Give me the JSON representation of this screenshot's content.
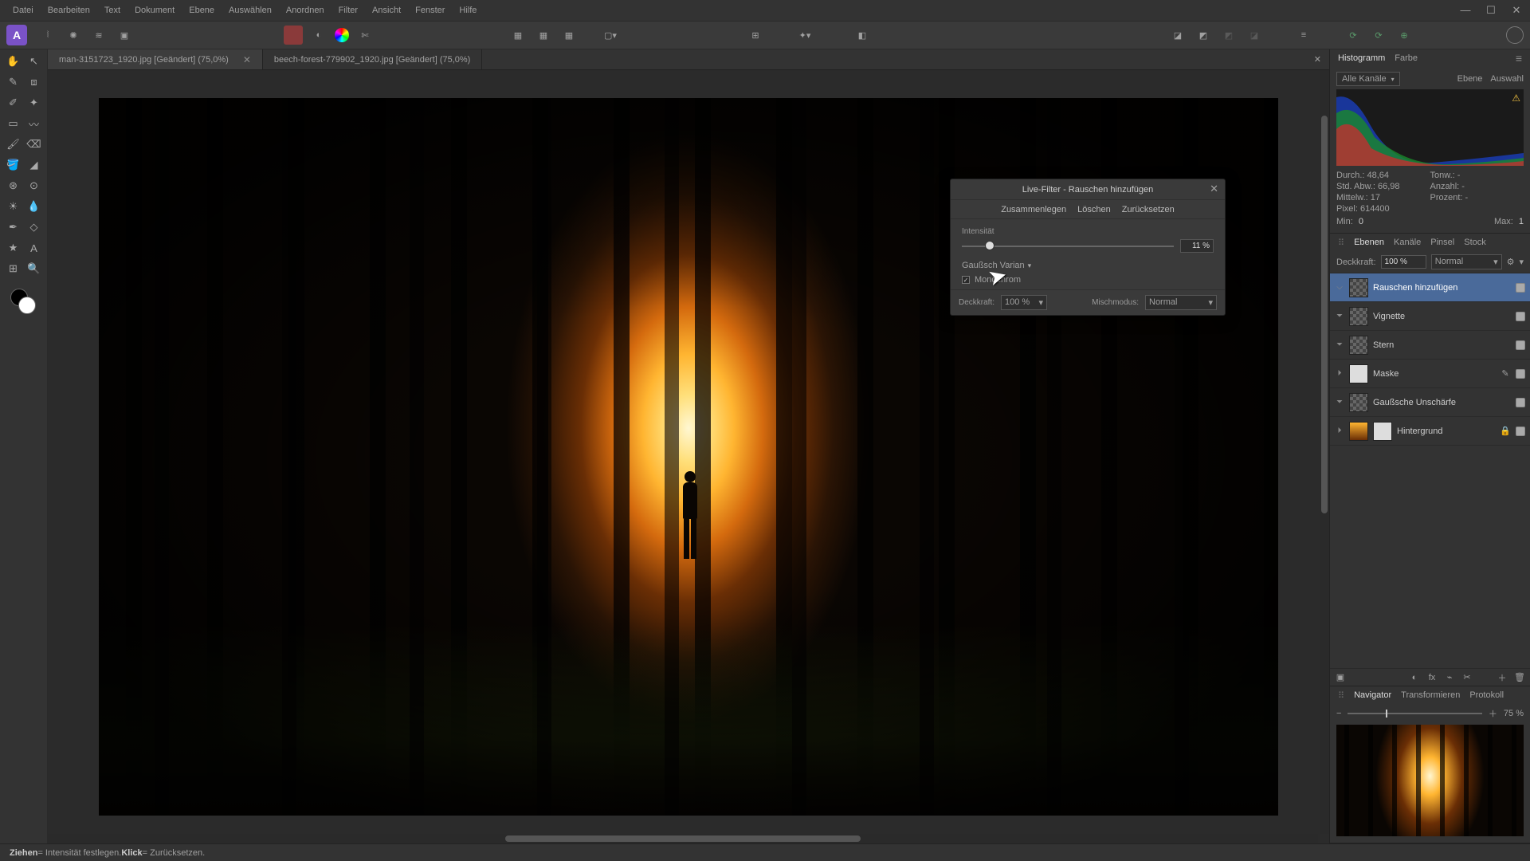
{
  "menu": [
    "Datei",
    "Bearbeiten",
    "Text",
    "Dokument",
    "Ebene",
    "Auswählen",
    "Anordnen",
    "Filter",
    "Ansicht",
    "Fenster",
    "Hilfe"
  ],
  "tabs": [
    {
      "label": "man-3151723_1920.jpg [Geändert] (75,0%)"
    },
    {
      "label": "beech-forest-779902_1920.jpg [Geändert] (75,0%)"
    }
  ],
  "dialog": {
    "title": "Live-Filter - Rauschen hinzufügen",
    "actions": [
      "Zusammenlegen",
      "Löschen",
      "Zurücksetzen"
    ],
    "intensity_label": "Intensität",
    "intensity_value": "11 %",
    "intensity_pct": 11,
    "distribution": "Gaußsch Varian",
    "mono_label": "Monochrom",
    "mono_checked": true,
    "opacity_label": "Deckkraft:",
    "opacity_value": "100 %",
    "blend_label": "Mischmodus:",
    "blend_value": "Normal"
  },
  "histogram": {
    "tabs": [
      "Histogramm",
      "Farbe"
    ],
    "channel": "Alle Kanäle",
    "links": [
      "Ebene",
      "Auswahl"
    ],
    "stats": {
      "durch": "Durch.: 48,64",
      "stdabw": "Std. Abw.: 66,98",
      "mittelw": "Mittelw.: 17",
      "pixel": "Pixel: 614400",
      "tonw": "Tonw.: -",
      "anzahl": "Anzahl: -",
      "prozent": "Prozent: -"
    },
    "min_label": "Min:",
    "min_value": "0",
    "max_label": "Max:",
    "max_value": "1"
  },
  "layers_panel": {
    "tabs": [
      "Ebenen",
      "Kanäle",
      "Pinsel",
      "Stock"
    ],
    "opacity_label": "Deckkraft:",
    "opacity_value": "100 %",
    "blend_value": "Normal",
    "items": [
      {
        "name": "Rauschen hinzufügen",
        "selected": true,
        "thumb": "pattern",
        "toggle": "⌵"
      },
      {
        "name": "Vignette",
        "thumb": "pattern",
        "toggle": "⏷"
      },
      {
        "name": "Stern",
        "thumb": "pattern",
        "toggle": "⏷"
      },
      {
        "name": "Maske",
        "thumb": "white",
        "toggle": "⏵",
        "extra_icon": true
      },
      {
        "name": "Gaußsche Unschärfe",
        "thumb": "pattern",
        "toggle": "⏷"
      },
      {
        "name": "Hintergrund",
        "thumb": "img",
        "toggle": "⏵",
        "lock": true,
        "double": true
      }
    ]
  },
  "navigator": {
    "tabs": [
      "Navigator",
      "Transformieren",
      "Protokoll"
    ],
    "zoom": "75 %"
  },
  "status": {
    "drag": "Ziehen",
    "drag_text": " = Intensität festlegen. ",
    "click": "Klick",
    "click_text": " = Zurücksetzen."
  }
}
